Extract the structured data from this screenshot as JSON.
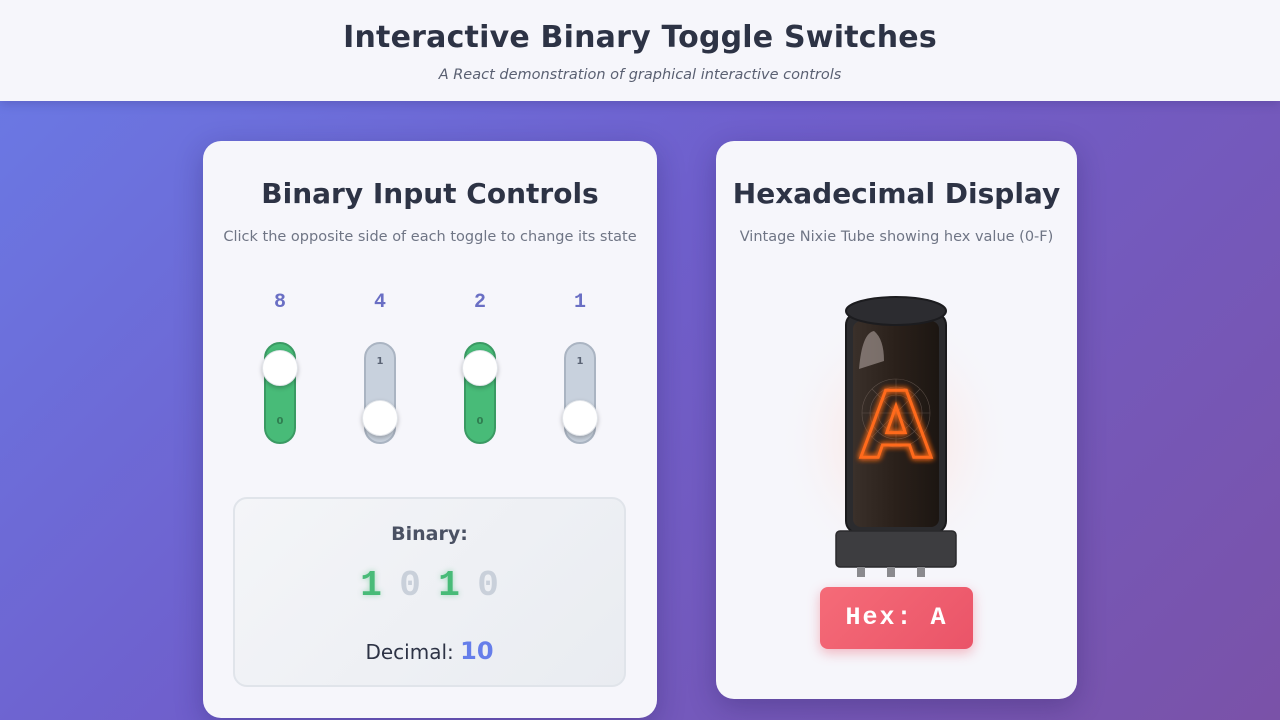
{
  "header": {
    "title": "Interactive Binary Toggle Switches",
    "subtitle": "A React demonstration of graphical interactive controls"
  },
  "input_panel": {
    "title": "Binary Input Controls",
    "instructions": "Click the opposite side of each toggle to change its state",
    "toggles": [
      {
        "weight": "8",
        "on": true,
        "top_label": "1",
        "bottom_label": "0"
      },
      {
        "weight": "4",
        "on": false,
        "top_label": "1",
        "bottom_label": "0"
      },
      {
        "weight": "2",
        "on": true,
        "top_label": "1",
        "bottom_label": "0"
      },
      {
        "weight": "1",
        "on": false,
        "top_label": "1",
        "bottom_label": "0"
      }
    ],
    "binary_label": "Binary:",
    "bits": [
      "1",
      "0",
      "1",
      "0"
    ],
    "decimal_label": "Decimal:",
    "decimal_value": "10"
  },
  "display_panel": {
    "title": "Hexadecimal Display",
    "subtitle": "Vintage Nixie Tube showing hex value (0-F)",
    "nixie_digit": "A",
    "hex_label": "Hex: A"
  },
  "colors": {
    "on": "#48bb78",
    "off": "#c8d1dd",
    "accent": "#667eea",
    "nixie_glow": "#ff6a1a",
    "hex_badge": "#f06272"
  }
}
